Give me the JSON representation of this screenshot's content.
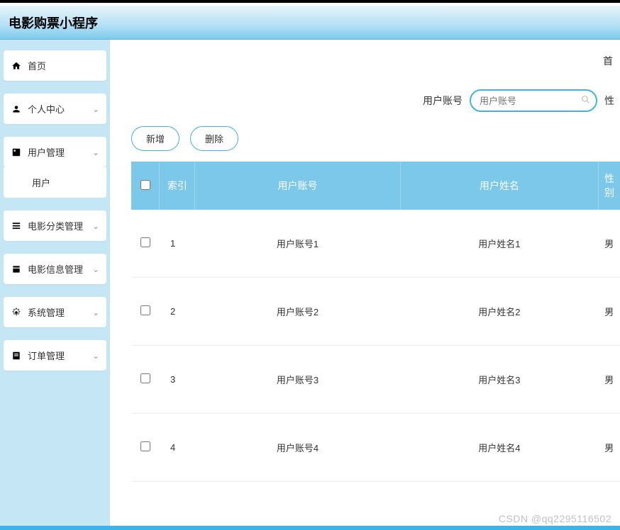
{
  "header": {
    "title": "电影购票小程序"
  },
  "sidebar": {
    "items": [
      {
        "icon": "home",
        "label": "首页",
        "expandable": false
      },
      {
        "icon": "person",
        "label": "个人中心",
        "expandable": true
      },
      {
        "icon": "users",
        "label": "用户管理",
        "expandable": true,
        "expanded": true,
        "children": [
          {
            "label": "用户"
          }
        ]
      },
      {
        "icon": "list",
        "label": "电影分类管理",
        "expandable": true
      },
      {
        "icon": "film",
        "label": "电影信息管理",
        "expandable": true
      },
      {
        "icon": "gear",
        "label": "系统管理",
        "expandable": true
      },
      {
        "icon": "order",
        "label": "订单管理",
        "expandable": true
      }
    ]
  },
  "breadcrumb": {
    "text": "首"
  },
  "search": {
    "label": "用户账号",
    "placeholder": "用户账号",
    "extra_label": "性"
  },
  "actions": {
    "add": "新增",
    "delete": "删除"
  },
  "table": {
    "headers": {
      "index": "索引",
      "account": "用户账号",
      "name": "用户姓名",
      "gender": "性别"
    },
    "rows": [
      {
        "index": "1",
        "account": "用户账号1",
        "name": "用户姓名1",
        "gender": "男"
      },
      {
        "index": "2",
        "account": "用户账号2",
        "name": "用户姓名2",
        "gender": "男"
      },
      {
        "index": "3",
        "account": "用户账号3",
        "name": "用户姓名3",
        "gender": "男"
      },
      {
        "index": "4",
        "account": "用户账号4",
        "name": "用户姓名4",
        "gender": "男"
      }
    ]
  },
  "watermark": "CSDN @qq2295116502"
}
